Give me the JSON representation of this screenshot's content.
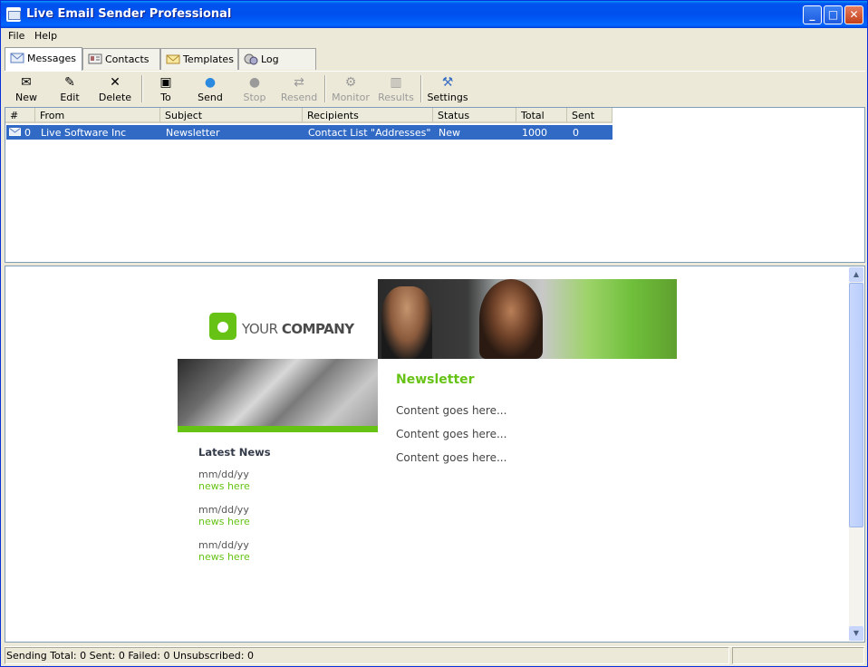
{
  "window": {
    "title": "Live Email Sender Professional"
  },
  "menu": {
    "file": "File",
    "help": "Help"
  },
  "tabs": [
    {
      "label": "Messages"
    },
    {
      "label": "Contacts"
    },
    {
      "label": "Templates"
    },
    {
      "label": "Log"
    }
  ],
  "toolbar": {
    "new": "New",
    "edit": "Edit",
    "delete": "Delete",
    "to": "To",
    "send": "Send",
    "stop": "Stop",
    "resend": "Resend",
    "monitor": "Monitor",
    "results": "Results",
    "settings": "Settings"
  },
  "table": {
    "headers": [
      "#",
      "From",
      "Subject",
      "Recipients",
      "Status",
      "Total",
      "Sent"
    ],
    "rows": [
      {
        "num": "0",
        "from": "Live Software Inc",
        "subject": "Newsletter",
        "recipients": "Contact List \"Addresses\"",
        "status": "New",
        "total": "1000",
        "sent": "0"
      }
    ]
  },
  "preview": {
    "logo_light": "YOUR ",
    "logo_bold": "COMPANY",
    "latest_news": "Latest News",
    "news": [
      {
        "date": "mm/dd/yy",
        "link": "news here"
      },
      {
        "date": "mm/dd/yy",
        "link": "news here"
      },
      {
        "date": "mm/dd/yy",
        "link": "news here"
      }
    ],
    "newsletter_title": "Newsletter",
    "content": [
      "Content goes here...",
      "Content goes here...",
      "Content goes here..."
    ]
  },
  "status": {
    "text": "Sending  Total: 0  Sent: 0  Failed: 0  Unsubscribed: 0"
  },
  "colors": {
    "accent_green": "#66c315",
    "selection": "#316ac5",
    "titlebar": "#0054e3"
  }
}
